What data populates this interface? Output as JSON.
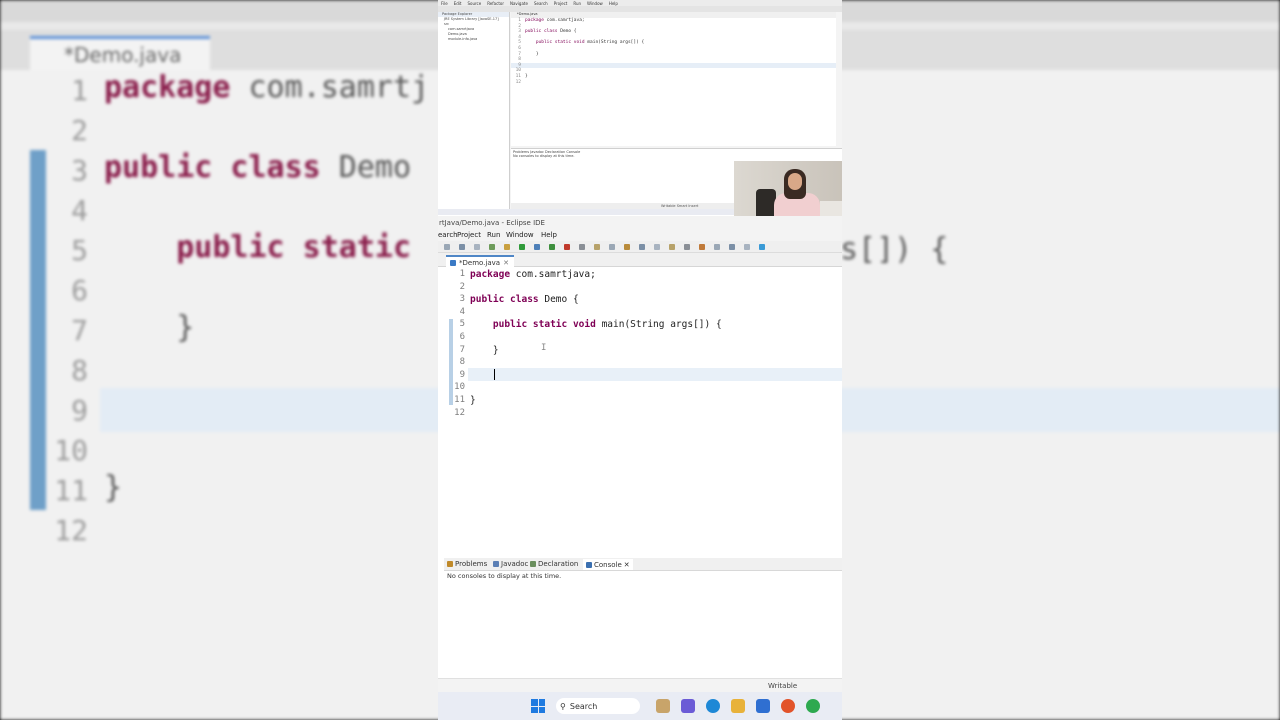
{
  "background_zoom": {
    "tab_label": "*Demo.java",
    "lines": [
      {
        "num": "1",
        "code": "package com.samrtj"
      },
      {
        "num": "2",
        "code": ""
      },
      {
        "num": "3",
        "code": "public class Demo"
      },
      {
        "num": "4",
        "code": ""
      },
      {
        "num": "5",
        "code": "    public static"
      },
      {
        "num": "6",
        "code": ""
      },
      {
        "num": "7",
        "code": "    }"
      },
      {
        "num": "8",
        "code": ""
      },
      {
        "num": "9",
        "code": ""
      },
      {
        "num": "10",
        "code": ""
      },
      {
        "num": "11",
        "code": "}"
      },
      {
        "num": "12",
        "code": ""
      }
    ],
    "right_fragment": "s[]) {"
  },
  "mini_ide": {
    "menu": [
      "File",
      "Edit",
      "Source",
      "Refactor",
      "Navigate",
      "Search",
      "Project",
      "Run",
      "Window",
      "Help"
    ],
    "explorer_title": "Package Explorer",
    "explorer_items": [
      "JRE System Library [JavaSE-17]",
      "src",
      "com.samrtjava",
      "Demo.java",
      "module-info.java"
    ],
    "editor_tab": "*Demo.java",
    "code": [
      {
        "num": "1",
        "kw": "package",
        "rest": " com.samrtjava;"
      },
      {
        "num": "2",
        "kw": "",
        "rest": ""
      },
      {
        "num": "3",
        "kw": "public class",
        "rest": " Demo {"
      },
      {
        "num": "4",
        "kw": "",
        "rest": ""
      },
      {
        "num": "5",
        "kw": "    public static void",
        "rest": " main(String args[]) {"
      },
      {
        "num": "6",
        "kw": "",
        "rest": ""
      },
      {
        "num": "7",
        "kw": "",
        "rest": "    }"
      },
      {
        "num": "8",
        "kw": "",
        "rest": ""
      },
      {
        "num": "9",
        "kw": "",
        "rest": ""
      },
      {
        "num": "10",
        "kw": "",
        "rest": ""
      },
      {
        "num": "11",
        "kw": "",
        "rest": "}"
      },
      {
        "num": "12",
        "kw": "",
        "rest": ""
      }
    ],
    "console_tabs": "Problems  Javadoc  Declaration  Console",
    "console_msg": "No consoles to display at this time.",
    "status": "Writable    Smart Insert"
  },
  "ide": {
    "title": "rtJava/Demo.java - Eclipse IDE",
    "menu": [
      {
        "label": "earch"
      },
      {
        "label": "Project"
      },
      {
        "label": "Run"
      },
      {
        "label": "Window"
      },
      {
        "label": "Help"
      }
    ],
    "editor_tab": "*Demo.java",
    "code": [
      {
        "num": "1",
        "kw": "package",
        "rest": " com.samrtjava;"
      },
      {
        "num": "2",
        "kw": "",
        "rest": ""
      },
      {
        "num": "3",
        "kw": "public class",
        "rest": " Demo {"
      },
      {
        "num": "4",
        "kw": "",
        "rest": ""
      },
      {
        "num": "5",
        "kw": "    public static void",
        "rest": " main(String args[]) {"
      },
      {
        "num": "6",
        "kw": "",
        "rest": ""
      },
      {
        "num": "7",
        "kw": "",
        "rest": "    }"
      },
      {
        "num": "8",
        "kw": "",
        "rest": ""
      },
      {
        "num": "9",
        "kw": "",
        "rest": ""
      },
      {
        "num": "10",
        "kw": "",
        "rest": ""
      },
      {
        "num": "11",
        "kw": "",
        "rest": "}"
      },
      {
        "num": "12",
        "kw": "",
        "rest": ""
      }
    ],
    "console_tabs": [
      {
        "label": "Problems",
        "color": "#c08a2a"
      },
      {
        "label": "Javadoc",
        "color": "#5b7fb5"
      },
      {
        "label": "Declaration",
        "color": "#6a8f5e"
      },
      {
        "label": "Console",
        "color": "#3a6fb0"
      }
    ],
    "console_msg": "No consoles to display at this time.",
    "status_writable": "Writable"
  },
  "taskbar": {
    "search_label": "Search",
    "apps": [
      "weather-icon",
      "teams-icon",
      "edge-icon",
      "file-explorer-icon",
      "mail-icon",
      "firefox-icon",
      "chrome-icon"
    ]
  },
  "colors": {
    "keyword": "#7f0055",
    "accent": "#4f86c6",
    "current_line": "#e8f0f8"
  }
}
